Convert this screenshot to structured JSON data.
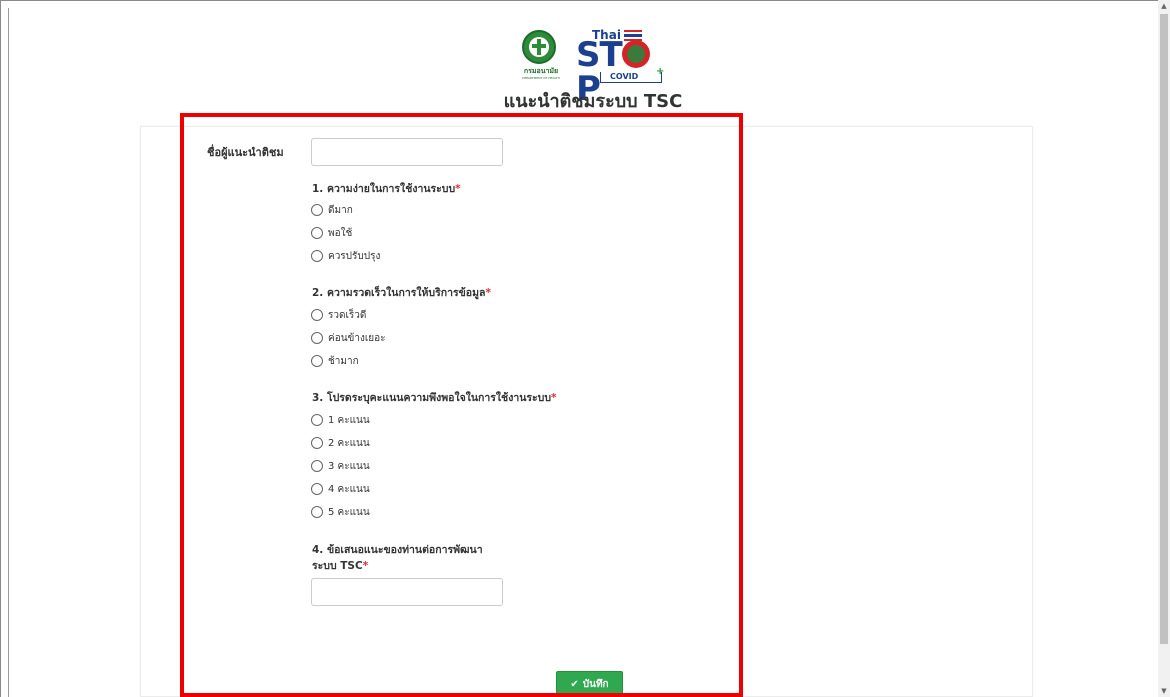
{
  "header": {
    "moph_logo_text": "กรมอนามัย",
    "moph_logo_subtext": "DEPARTMENT OF HEALTH",
    "campaign_logo": {
      "thai": "Thai",
      "stop": "STOP",
      "covid": "COVID",
      "plus": "+"
    },
    "title": "แนะนำติชมระบบ TSC"
  },
  "form": {
    "name_label": "ชื่อผู้แนะนำติชม",
    "name_value": "",
    "questions": [
      {
        "label": "1. ความง่ายในการใช้งานระบบ",
        "required": "*",
        "options": [
          "ดีมาก",
          "พอใช้",
          "ควรปรับปรุง"
        ]
      },
      {
        "label": "2. ความรวดเร็วในการให้บริการข้อมูล",
        "required": "*",
        "options": [
          "รวดเร็วดี",
          "ค่อนข้างเยอะ",
          "ช้ามาก"
        ]
      },
      {
        "label": "3. โปรดระบุคะแนนความพึงพอใจในการใช้งานระบบ",
        "required": "*",
        "options": [
          "1 คะแนน",
          "2 คะแนน",
          "3 คะแนน",
          "4 คะแนน",
          "5 คะแนน"
        ]
      }
    ],
    "suggestion": {
      "label_line1": "4. ข้อเสนอแนะของท่านต่อการพัฒนา",
      "label_line2": "ระบบ TSC",
      "required": "*",
      "value": ""
    },
    "save_label": "บันทึก"
  },
  "colors": {
    "accent_green": "#2fa84f",
    "required_red": "#e02d2d",
    "highlight_red": "#ee0000",
    "brand_blue": "#1c3f8f"
  },
  "icons": {
    "save": "check-icon",
    "moph": "moph-emblem-icon"
  }
}
